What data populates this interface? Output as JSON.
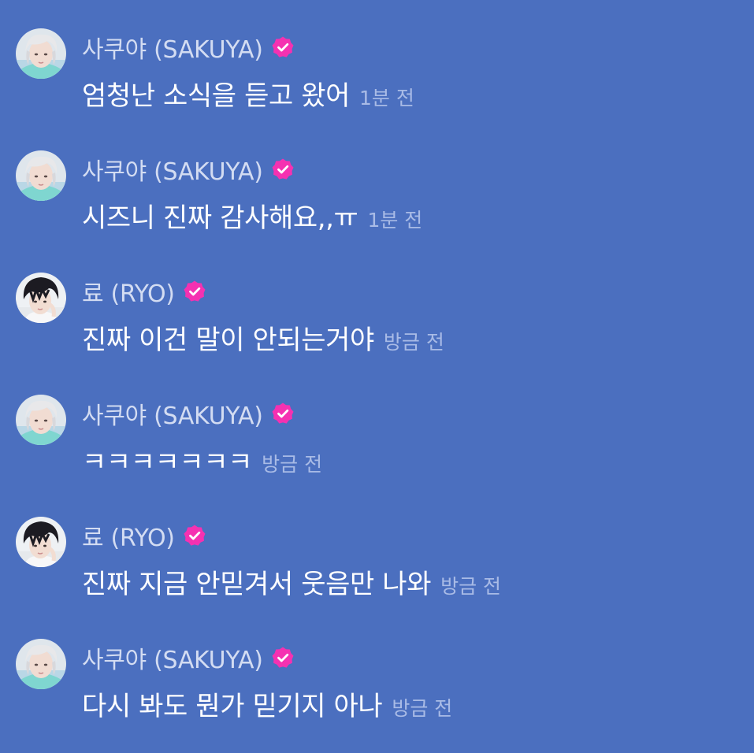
{
  "colors": {
    "background": "#4b6fbf",
    "author_text": "#d3dcf2",
    "message_text": "#ffffff",
    "timestamp_text": "#a9bbe6",
    "verified_badge": "#f531b1"
  },
  "icons": {
    "verified": "verified-badge-icon",
    "avatar_sakuya": "avatar-sakuya",
    "avatar_ryo": "avatar-ryo"
  },
  "messages": [
    {
      "author": "사쿠야 (SAKUYA)",
      "text": "엄청난 소식을 듣고 왔어",
      "time": "1분 전"
    },
    {
      "author": "사쿠야 (SAKUYA)",
      "text": "시즈니 진짜 감사해요,,ㅠ",
      "time": "1분 전"
    },
    {
      "author": "료 (RYO)",
      "text": "진짜 이건 말이 안되는거야",
      "time": "방금 전"
    },
    {
      "author": "사쿠야 (SAKUYA)",
      "text": "ㅋㅋㅋㅋㅋㅋㅋ",
      "time": "방금 전"
    },
    {
      "author": "료 (RYO)",
      "text": "진짜 지금 안믿겨서 웃음만 나와",
      "time": "방금 전"
    },
    {
      "author": "사쿠야 (SAKUYA)",
      "text": "다시 봐도 뭔가 믿기지 아나",
      "time": "방금 전"
    }
  ]
}
